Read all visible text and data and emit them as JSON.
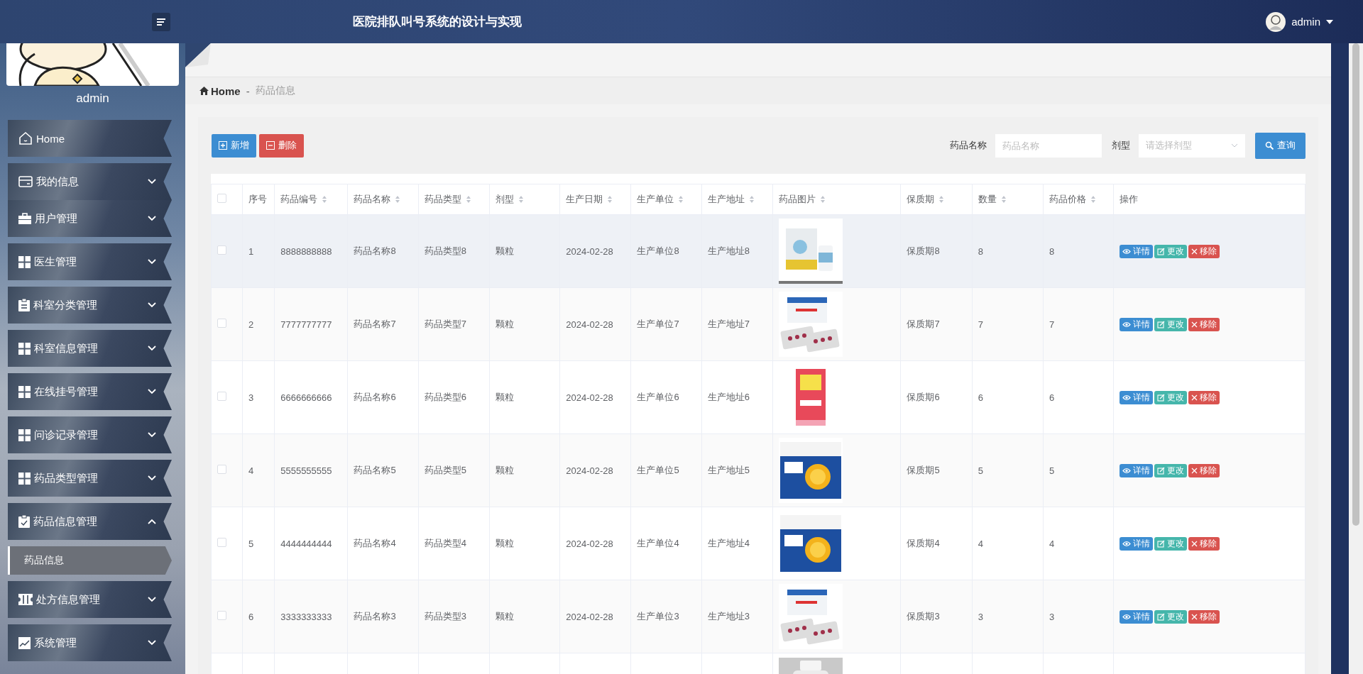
{
  "header": {
    "title": "医院排队叫号系统的设计与实现",
    "user": "admin"
  },
  "sidebar": {
    "user": "admin",
    "avatar": {
      "kind": "picture"
    },
    "items": [
      {
        "label": "Home"
      },
      {
        "label": "我的信息",
        "expanded": false
      },
      {
        "label": "用户管理",
        "expanded": false
      },
      {
        "label": "医生管理",
        "expanded": false
      },
      {
        "label": "科室分类管理",
        "expanded": false
      },
      {
        "label": "科室信息管理",
        "expanded": false
      },
      {
        "label": "在线挂号管理",
        "expanded": false
      },
      {
        "label": "问诊记录管理",
        "expanded": false
      },
      {
        "label": "药品类型管理",
        "expanded": false
      },
      {
        "label": "药品信息管理",
        "expanded": true,
        "children": [
          {
            "label": "药品信息",
            "selected": true
          }
        ]
      },
      {
        "label": "处方信息管理",
        "expanded": false
      },
      {
        "label": "系统管理",
        "expanded": false
      }
    ]
  },
  "breadcrumb": [
    "Home",
    "-",
    "药品信息"
  ],
  "toolbar": {
    "add": "新增",
    "delete": "删除",
    "name_label": "药品名称",
    "name_placeholder": "药品名称",
    "form_label": "剂型",
    "form_placeholder": "请选择剂型",
    "search": "查询"
  },
  "table": {
    "all_checked": false,
    "columns": [
      {
        "label": "序号",
        "sortable": false
      },
      {
        "label": "药品编号",
        "sortable": true
      },
      {
        "label": "药品名称",
        "sortable": true
      },
      {
        "label": "药品类型",
        "sortable": true
      },
      {
        "label": "剂型",
        "sortable": true
      },
      {
        "label": "生产日期",
        "sortable": true
      },
      {
        "label": "生产单位",
        "sortable": true
      },
      {
        "label": "生产地址",
        "sortable": true
      },
      {
        "label": "药品图片",
        "sortable": true
      },
      {
        "label": "保质期",
        "sortable": true
      },
      {
        "label": "数量",
        "sortable": true
      },
      {
        "label": "药品价格",
        "sortable": true
      },
      {
        "label": "操作",
        "sortable": false
      }
    ],
    "rows": [
      {
        "checked": false,
        "highlighted": true,
        "cells": [
          "1",
          "8888888888",
          "药品名称8",
          "药品类型8",
          "颗粒",
          "2024-02-28",
          "生产单位8",
          "生产地址8"
        ],
        "image": {
          "kind": "picture"
        },
        "cells_after": [
          "保质期8",
          "8",
          "8"
        ],
        "actions": [
          {
            "label": "详情",
            "kind": "view"
          },
          {
            "label": "更改",
            "kind": "edit"
          },
          {
            "label": "移除",
            "kind": "remove"
          }
        ]
      },
      {
        "checked": false,
        "highlighted": false,
        "cells": [
          "2",
          "7777777777",
          "药品名称7",
          "药品类型7",
          "颗粒",
          "2024-02-28",
          "生产单位7",
          "生产地址7"
        ],
        "image": {
          "kind": "picture"
        },
        "cells_after": [
          "保质期7",
          "7",
          "7"
        ],
        "actions": [
          {
            "label": "详情",
            "kind": "view"
          },
          {
            "label": "更改",
            "kind": "edit"
          },
          {
            "label": "移除",
            "kind": "remove"
          }
        ]
      },
      {
        "checked": false,
        "highlighted": false,
        "cells": [
          "3",
          "6666666666",
          "药品名称6",
          "药品类型6",
          "颗粒",
          "2024-02-28",
          "生产单位6",
          "生产地址6"
        ],
        "image": {
          "kind": "picture"
        },
        "cells_after": [
          "保质期6",
          "6",
          "6"
        ],
        "actions": [
          {
            "label": "详情",
            "kind": "view"
          },
          {
            "label": "更改",
            "kind": "edit"
          },
          {
            "label": "移除",
            "kind": "remove"
          }
        ]
      },
      {
        "checked": false,
        "highlighted": false,
        "cells": [
          "4",
          "5555555555",
          "药品名称5",
          "药品类型5",
          "颗粒",
          "2024-02-28",
          "生产单位5",
          "生产地址5"
        ],
        "image": {
          "kind": "picture"
        },
        "cells_after": [
          "保质期5",
          "5",
          "5"
        ],
        "actions": [
          {
            "label": "详情",
            "kind": "view"
          },
          {
            "label": "更改",
            "kind": "edit"
          },
          {
            "label": "移除",
            "kind": "remove"
          }
        ]
      },
      {
        "checked": false,
        "highlighted": false,
        "cells": [
          "5",
          "4444444444",
          "药品名称4",
          "药品类型4",
          "颗粒",
          "2024-02-28",
          "生产单位4",
          "生产地址4"
        ],
        "image": {
          "kind": "picture"
        },
        "cells_after": [
          "保质期4",
          "4",
          "4"
        ],
        "actions": [
          {
            "label": "详情",
            "kind": "view"
          },
          {
            "label": "更改",
            "kind": "edit"
          },
          {
            "label": "移除",
            "kind": "remove"
          }
        ]
      },
      {
        "checked": false,
        "highlighted": false,
        "cells": [
          "6",
          "3333333333",
          "药品名称3",
          "药品类型3",
          "颗粒",
          "2024-02-28",
          "生产单位3",
          "生产地址3"
        ],
        "image": {
          "kind": "picture"
        },
        "cells_after": [
          "保质期3",
          "3",
          "3"
        ],
        "actions": [
          {
            "label": "详情",
            "kind": "view"
          },
          {
            "label": "更改",
            "kind": "edit"
          },
          {
            "label": "移除",
            "kind": "remove"
          }
        ]
      },
      {
        "image": {
          "kind": "picture"
        }
      }
    ]
  }
}
